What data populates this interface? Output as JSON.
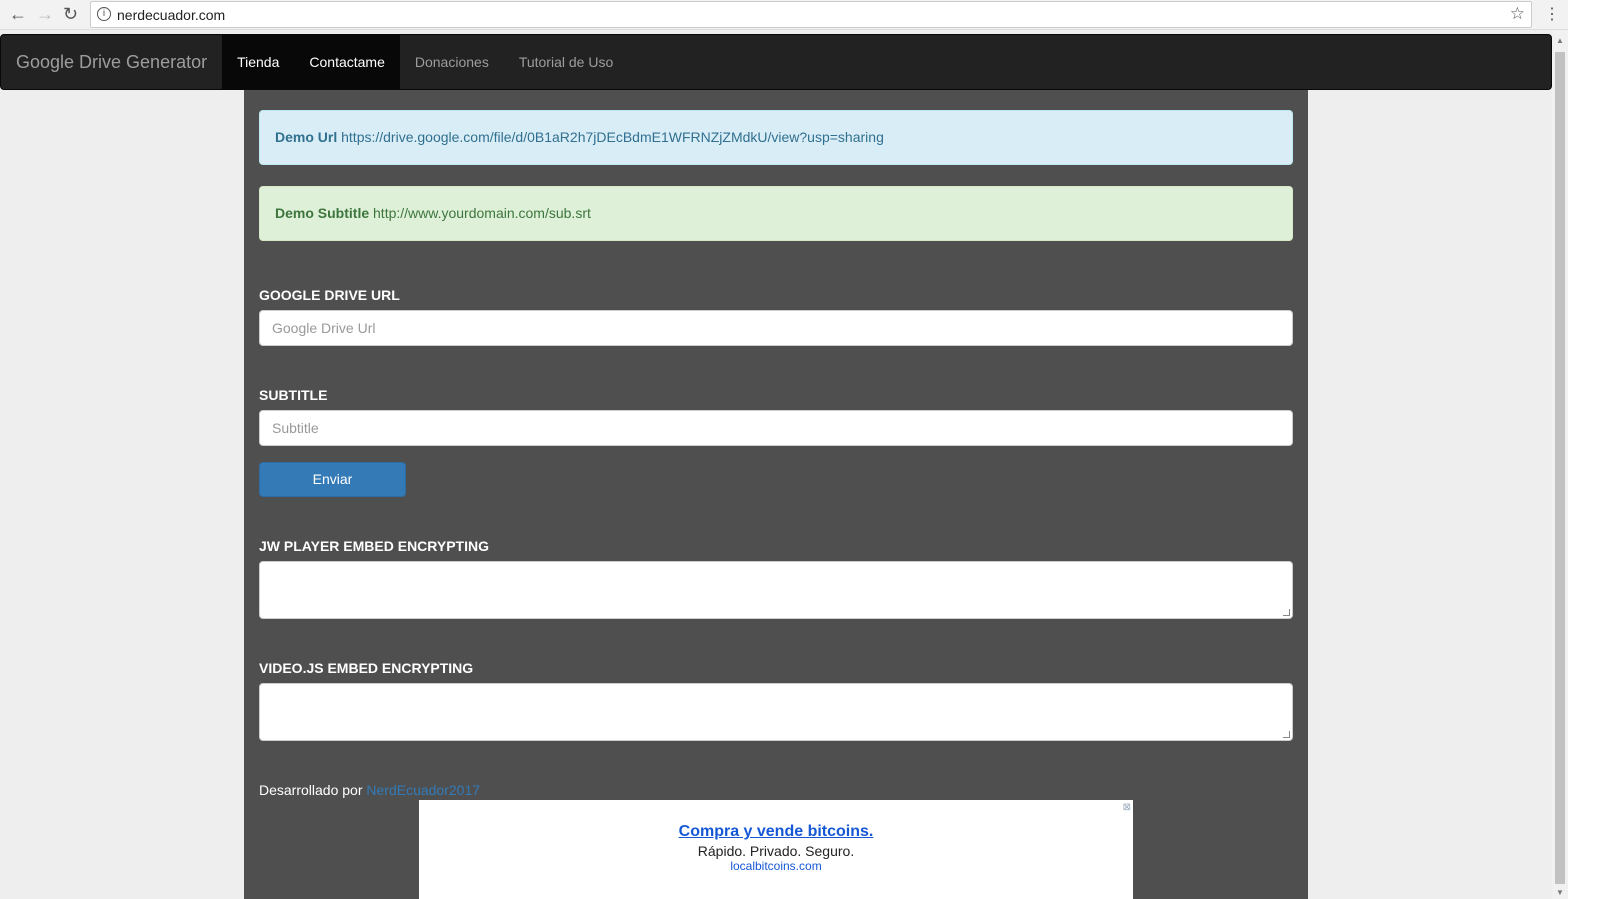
{
  "browser": {
    "url": "nerdecuador.com"
  },
  "navbar": {
    "brand": "Google Drive Generator",
    "items": [
      {
        "label": "Tienda"
      },
      {
        "label": "Contactame"
      },
      {
        "label": "Donaciones"
      },
      {
        "label": "Tutorial de Uso"
      }
    ]
  },
  "alerts": {
    "demo_url_label": "Demo Url",
    "demo_url": "https://drive.google.com/file/d/0B1aR2h7jDEcBdmE1WFRNZjZMdkU/view?usp=sharing",
    "demo_sub_label": "Demo Subtitle",
    "demo_sub": "http://www.yourdomain.com/sub.srt"
  },
  "form": {
    "drive_label": "GOOGLE DRIVE URL",
    "drive_placeholder": "Google Drive Url",
    "sub_label": "SUBTITLE",
    "sub_placeholder": "Subtitle",
    "submit": "Enviar",
    "jw_label": "JW PLAYER EMBED ENCRYPTING",
    "videojs_label": "VIDEO.JS EMBED ENCRYPTING"
  },
  "footer": {
    "text": "Desarrollado por",
    "link": "NerdEcuador2017"
  },
  "ad": {
    "title": "Compra y vende bitcoins.",
    "subtitle": "Rápido. Privado. Seguro.",
    "domain": "localbitcoins.com"
  }
}
